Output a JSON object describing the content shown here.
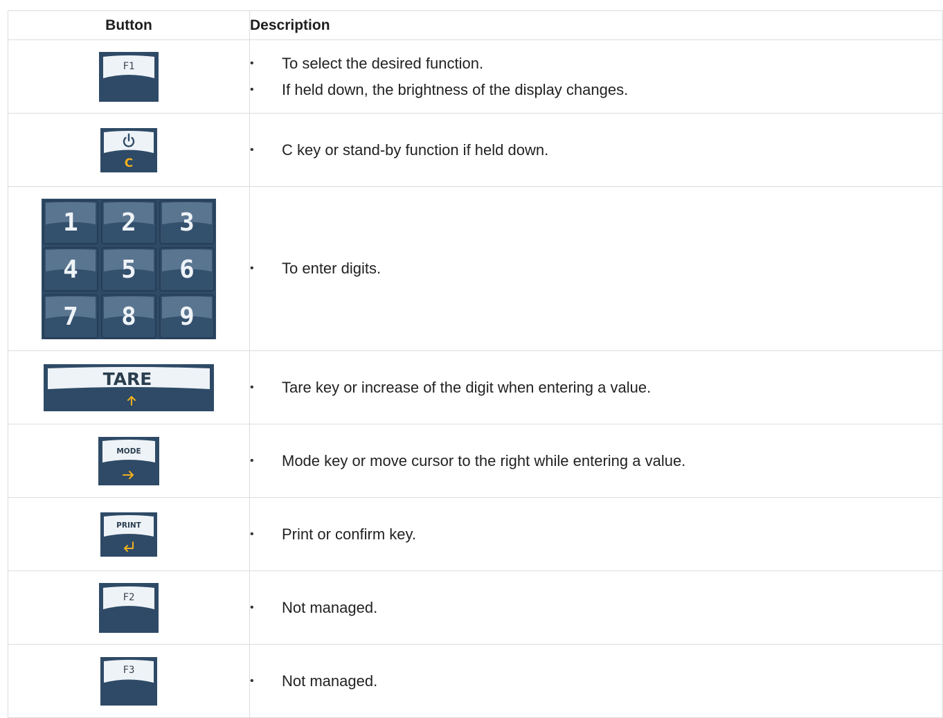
{
  "table": {
    "headers": {
      "button": "Button",
      "description": "Description"
    },
    "rows": [
      {
        "key": "F1",
        "items": [
          "To select the desired function.",
          "If held down, the brightness of the display changes."
        ]
      },
      {
        "key_icon": "power-icon",
        "key_letter": "C",
        "items": [
          "C key or stand-by function if held down."
        ]
      },
      {
        "digits": [
          "1",
          "2",
          "3",
          "4",
          "5",
          "6",
          "7",
          "8",
          "9"
        ],
        "items": [
          "To enter digits."
        ]
      },
      {
        "key": "TARE",
        "key_icon": "arrow-up-icon",
        "items": [
          "Tare key or increase of the digit when entering a value."
        ]
      },
      {
        "key": "MODE",
        "key_icon": "arrow-right-icon",
        "items": [
          "Mode key or move cursor to the right while entering a value."
        ]
      },
      {
        "key": "PRINT",
        "key_icon": "enter-icon",
        "items": [
          "Print or confirm key."
        ]
      },
      {
        "key": "F2",
        "items": [
          "Not managed."
        ]
      },
      {
        "key": "F3",
        "items": [
          "Not managed."
        ]
      }
    ]
  },
  "colors": {
    "key_body": "#2e4a66",
    "key_face": "#eef3f7",
    "key_accent": "#f2b01e",
    "border": "#dcdcdc"
  }
}
